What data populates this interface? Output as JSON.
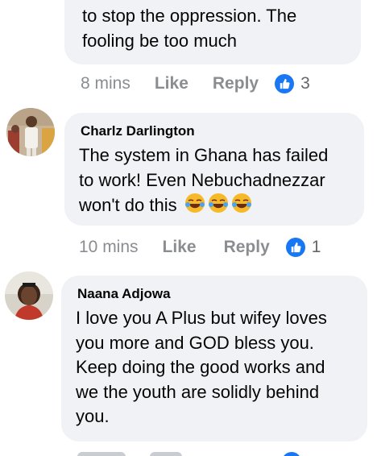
{
  "comments": [
    {
      "author": "",
      "text": [
        "to stop the oppression. The",
        "fooling be too much"
      ],
      "time": "8 mins",
      "like": "Like",
      "reply": "Reply",
      "reactions": "3"
    },
    {
      "author": "Charlz Darlington",
      "text": [
        "The system in Ghana has failed",
        "to work! Even Nebuchadnezzar",
        "won't do this"
      ],
      "emojis": [
        "laughing-face-icon",
        "laughing-face-icon",
        "laughing-face-icon"
      ],
      "time": "10 mins",
      "like": "Like",
      "reply": "Reply",
      "reactions": "1"
    },
    {
      "author": "Naana Adjowa",
      "text": [
        "I love you A Plus but wifey loves",
        "you more and GOD bless you.",
        "Keep doing the good works and",
        "we the youth are solidly behind",
        "you."
      ],
      "time": "",
      "like": "",
      "reply": "",
      "reactions": ""
    }
  ],
  "colors": {
    "bubble": "#f0f2f5",
    "reaction_blue": "#1877f2",
    "meta_gray": "#8a8d91",
    "text": "#050505"
  }
}
